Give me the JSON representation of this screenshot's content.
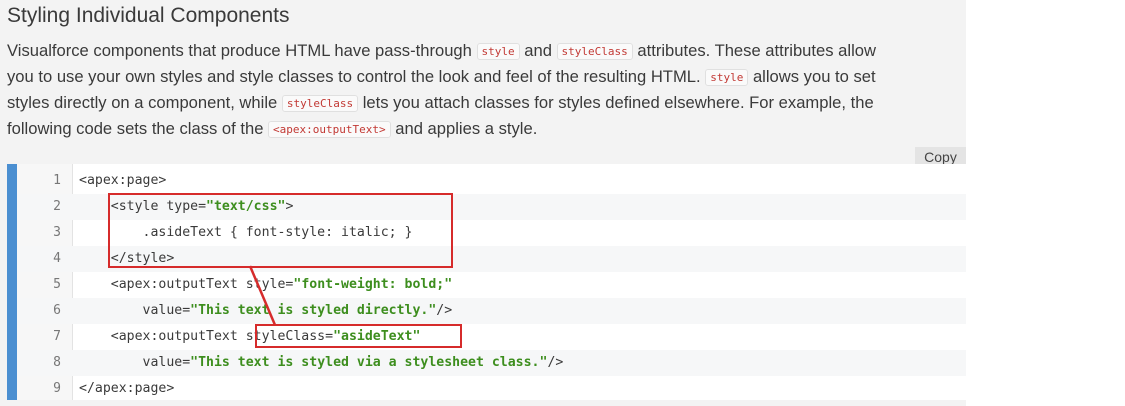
{
  "article": {
    "heading": "Styling Individual Components",
    "para": {
      "l1_a": "Visualforce components that produce HTML have pass-through ",
      "l1_code1": "style",
      "l1_b": " and ",
      "l1_code2": "styleClass",
      "l1_c": " attributes. These attributes allow",
      "l2_a": "you to use your own styles and style classes to control the look and feel of the resulting HTML. ",
      "l2_code": "style",
      "l2_b": " allows you to set",
      "l3_a": "styles directly on a component, while ",
      "l3_code": "styleClass",
      "l3_b": " lets you attach classes for styles defined elsewhere. For example, the",
      "l4_a": "following code sets the class of the ",
      "l4_code": "<apex:outputText>",
      "l4_b": " and applies a style."
    }
  },
  "code_block": {
    "copy_label": "Copy",
    "lines": [
      {
        "num": "1",
        "pre": "<apex:page>"
      },
      {
        "num": "2",
        "pre": "    <style type=",
        "str": "\"text/css\"",
        "post": ">"
      },
      {
        "num": "3",
        "pre": "        .asideText { font-style: italic; }"
      },
      {
        "num": "4",
        "pre": "    </style>"
      },
      {
        "num": "5",
        "pre": "    <apex:outputText style=",
        "str": "\"font-weight: bold;\""
      },
      {
        "num": "6",
        "pre": "        value=",
        "str": "\"This text is styled directly.\"",
        "post": "/>"
      },
      {
        "num": "7",
        "pre": "    <apex:outputText styleClass=",
        "str": "\"asideText\""
      },
      {
        "num": "8",
        "pre": "        value=",
        "str": "\"This text is styled via a stylesheet class.\"",
        "post": "/>"
      },
      {
        "num": "9",
        "pre": "</apex:page>"
      }
    ]
  },
  "colors": {
    "accent_bar": "#4b8fd1",
    "string_literal": "#3d8e1e",
    "annotation": "#d62b2b",
    "inline_code": "#c23934"
  }
}
